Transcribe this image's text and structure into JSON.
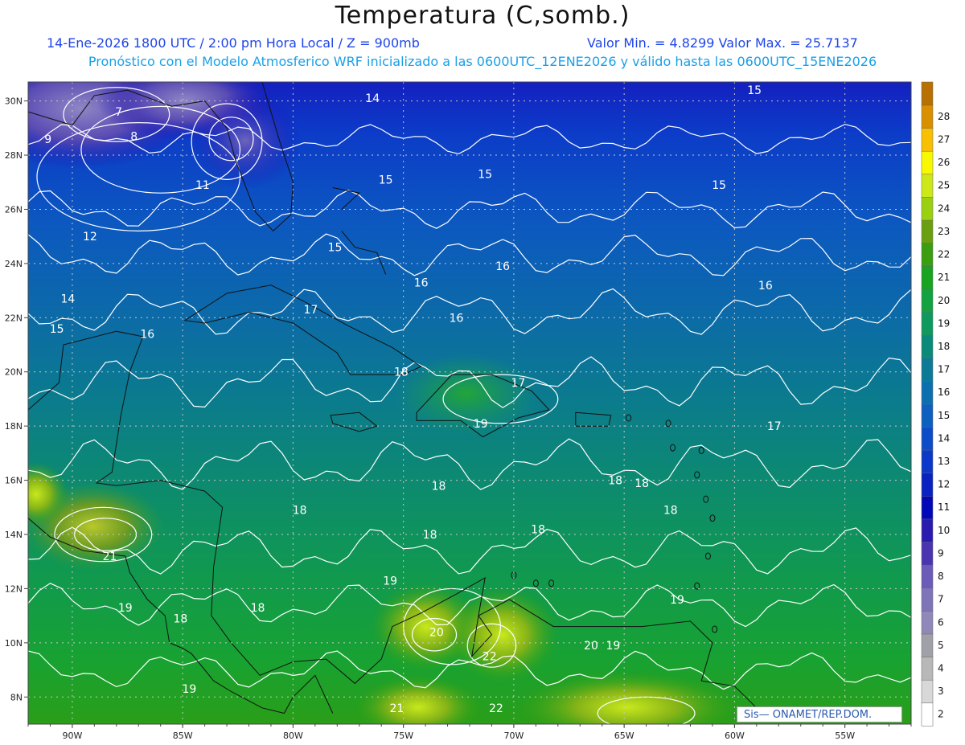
{
  "title": "Temperatura (C,somb.)",
  "subtitle_left": "14-Ene-2026  1800 UTC / 2:00 pm Hora Local / Z = 900mb",
  "subtitle_right": "Valor Min. = 4.8299  Valor Max. = 25.7137",
  "subtitle2": "Pronóstico con el Modelo Atmosferico WRF inicializado a las 0600UTC_12ENE2026 y válido hasta las  0600UTC_15ENE2026",
  "credit": "Sis—  ONAMET/REP.DOM.",
  "chart_data": {
    "type": "heatmap",
    "variable": "Temperatura",
    "units": "C",
    "level": "900mb",
    "valid_time": "14-Ene-2026 1800 UTC",
    "value_min": 4.8299,
    "value_max": 25.7137,
    "xlim": [
      -92,
      -52
    ],
    "ylim": [
      7,
      30.7
    ],
    "x_ticks": [
      {
        "lon": -90,
        "label": "90W"
      },
      {
        "lon": -85,
        "label": "85W"
      },
      {
        "lon": -80,
        "label": "80W"
      },
      {
        "lon": -75,
        "label": "75W"
      },
      {
        "lon": -70,
        "label": "70W"
      },
      {
        "lon": -65,
        "label": "65W"
      },
      {
        "lon": -60,
        "label": "60W"
      },
      {
        "lon": -55,
        "label": "55W"
      }
    ],
    "y_ticks": [
      {
        "lat": 8,
        "label": "8N"
      },
      {
        "lat": 10,
        "label": "10N"
      },
      {
        "lat": 12,
        "label": "12N"
      },
      {
        "lat": 14,
        "label": "14N"
      },
      {
        "lat": 16,
        "label": "16N"
      },
      {
        "lat": 18,
        "label": "18N"
      },
      {
        "lat": 20,
        "label": "20N"
      },
      {
        "lat": 22,
        "label": "22N"
      },
      {
        "lat": 24,
        "label": "24N"
      },
      {
        "lat": 26,
        "label": "26N"
      },
      {
        "lat": 28,
        "label": "28N"
      },
      {
        "lat": 30,
        "label": "30N"
      }
    ],
    "colorbar": {
      "levels": [
        2,
        3,
        4,
        5,
        6,
        7,
        8,
        9,
        10,
        11,
        12,
        13,
        14,
        15,
        16,
        17,
        18,
        19,
        20,
        21,
        22,
        23,
        24,
        25,
        26,
        27,
        28
      ],
      "colors": [
        "#ffffff",
        "#d8d8d8",
        "#b8b8b8",
        "#a0a0a8",
        "#9088b8",
        "#7e74b8",
        "#6a5cb8",
        "#4a34b0",
        "#2a1ab0",
        "#0008b8",
        "#0a22c0",
        "#0a38c8",
        "#0c4cc8",
        "#0d5fc0",
        "#0c6fb0",
        "#0a7a96",
        "#0a8a7a",
        "#0e9a5e",
        "#12a242",
        "#18a420",
        "#3a9e10",
        "#6aa010",
        "#9ad010",
        "#cce818",
        "#f8f800",
        "#f8c000",
        "#d89000",
        "#b87000"
      ]
    },
    "contour_labels": [
      {
        "lon": -87.9,
        "lat": 29.6,
        "value": "7"
      },
      {
        "lon": -91.1,
        "lat": 28.6,
        "value": "9"
      },
      {
        "lon": -87.2,
        "lat": 28.7,
        "value": "8"
      },
      {
        "lon": -84.1,
        "lat": 26.9,
        "value": "11"
      },
      {
        "lon": -89.2,
        "lat": 25.0,
        "value": "12"
      },
      {
        "lon": -90.2,
        "lat": 22.7,
        "value": "14"
      },
      {
        "lon": -90.7,
        "lat": 21.6,
        "value": "15"
      },
      {
        "lon": -86.6,
        "lat": 21.4,
        "value": "16"
      },
      {
        "lon": -76.4,
        "lat": 30.1,
        "value": "14"
      },
      {
        "lon": -75.8,
        "lat": 27.1,
        "value": "15"
      },
      {
        "lon": -71.3,
        "lat": 27.3,
        "value": "15"
      },
      {
        "lon": -78.1,
        "lat": 24.6,
        "value": "15"
      },
      {
        "lon": -74.2,
        "lat": 23.3,
        "value": "16"
      },
      {
        "lon": -70.5,
        "lat": 23.9,
        "value": "16"
      },
      {
        "lon": -72.6,
        "lat": 22.0,
        "value": "16"
      },
      {
        "lon": -60.7,
        "lat": 26.9,
        "value": "15"
      },
      {
        "lon": -59.1,
        "lat": 30.4,
        "value": "15"
      },
      {
        "lon": -58.6,
        "lat": 23.2,
        "value": "16"
      },
      {
        "lon": -79.2,
        "lat": 22.3,
        "value": "17"
      },
      {
        "lon": -75.1,
        "lat": 20.0,
        "value": "18"
      },
      {
        "lon": -69.8,
        "lat": 19.6,
        "value": "17"
      },
      {
        "lon": -71.5,
        "lat": 18.1,
        "value": "19"
      },
      {
        "lon": -58.2,
        "lat": 18.0,
        "value": "17"
      },
      {
        "lon": -73.4,
        "lat": 15.8,
        "value": "18"
      },
      {
        "lon": -65.4,
        "lat": 16.0,
        "value": "18"
      },
      {
        "lon": -64.2,
        "lat": 15.9,
        "value": "18"
      },
      {
        "lon": -62.9,
        "lat": 14.9,
        "value": "18"
      },
      {
        "lon": -79.7,
        "lat": 14.9,
        "value": "18"
      },
      {
        "lon": -73.8,
        "lat": 14.0,
        "value": "18"
      },
      {
        "lon": -68.9,
        "lat": 14.2,
        "value": "18"
      },
      {
        "lon": -88.3,
        "lat": 13.2,
        "value": "21"
      },
      {
        "lon": -75.6,
        "lat": 12.3,
        "value": "19"
      },
      {
        "lon": -87.6,
        "lat": 11.3,
        "value": "19"
      },
      {
        "lon": -85.1,
        "lat": 10.9,
        "value": "18"
      },
      {
        "lon": -81.6,
        "lat": 11.3,
        "value": "18"
      },
      {
        "lon": -73.5,
        "lat": 10.4,
        "value": "20"
      },
      {
        "lon": -71.1,
        "lat": 9.5,
        "value": "22"
      },
      {
        "lon": -66.5,
        "lat": 9.9,
        "value": "20"
      },
      {
        "lon": -65.5,
        "lat": 9.9,
        "value": "19"
      },
      {
        "lon": -62.6,
        "lat": 11.6,
        "value": "19"
      },
      {
        "lon": -84.7,
        "lat": 8.3,
        "value": "19"
      },
      {
        "lon": -75.3,
        "lat": 7.6,
        "value": "21"
      },
      {
        "lon": -70.8,
        "lat": 7.6,
        "value": "22"
      }
    ],
    "grid": true,
    "legend_position": "right"
  }
}
